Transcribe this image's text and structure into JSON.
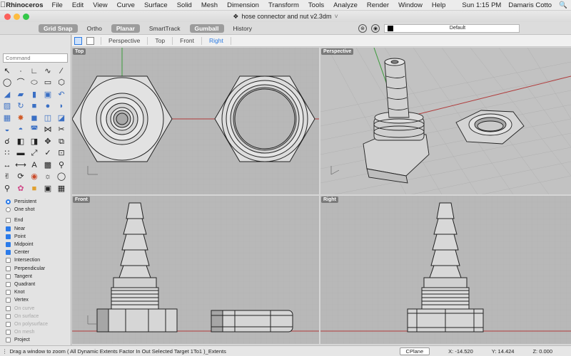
{
  "menubar": {
    "app_name": "Rhinoceros",
    "items": [
      "File",
      "Edit",
      "View",
      "Curve",
      "Surface",
      "Solid",
      "Mesh",
      "Dimension",
      "Transform",
      "Tools",
      "Analyze",
      "Render",
      "Window",
      "Help"
    ],
    "clock": "Sun 1:15 PM",
    "user": "Damaris Cotto"
  },
  "window": {
    "title": "hose connector and nut v2.3dm"
  },
  "toolbar": {
    "buttons": [
      "Grid Snap",
      "Ortho",
      "Planar",
      "SmartTrack",
      "Gumball",
      "History"
    ],
    "layer_name": "Default"
  },
  "command": {
    "placeholder": "Command"
  },
  "osnap": {
    "persistent": "Persistent",
    "one_shot": "One shot",
    "items": [
      "End",
      "Near",
      "Point",
      "Midpoint",
      "Center",
      "Intersection",
      "Perpendicular",
      "Tangent",
      "Quadrant",
      "Knot",
      "Vertex",
      "On curve",
      "On surface",
      "On polysurface",
      "On mesh",
      "Project"
    ],
    "checked": [
      "Near",
      "Point",
      "Midpoint",
      "Center"
    ],
    "disabled": [
      "On curve",
      "On surface",
      "On polysurface",
      "On mesh"
    ]
  },
  "viewport_tabs": [
    "Perspective",
    "Top",
    "Front",
    "Right"
  ],
  "viewports": {
    "top": "Top",
    "perspective": "Perspective",
    "front": "Front",
    "right": "Right"
  },
  "status": {
    "prompt": "Drag a window to zoom ( All Dynamic Extents Factor In Out Selected Target 1To1 )_Extents",
    "cplane": "CPlane",
    "x": "X: -14.520",
    "y": "Y: 14.424",
    "z": "Z: 0.000"
  },
  "colors": {
    "viewport_bg": "#b8b8b8",
    "grid": "#a9a9a9",
    "x_axis": "#b03a3a",
    "y_axis": "#3a9a3a",
    "accent": "#2a7ae2"
  }
}
